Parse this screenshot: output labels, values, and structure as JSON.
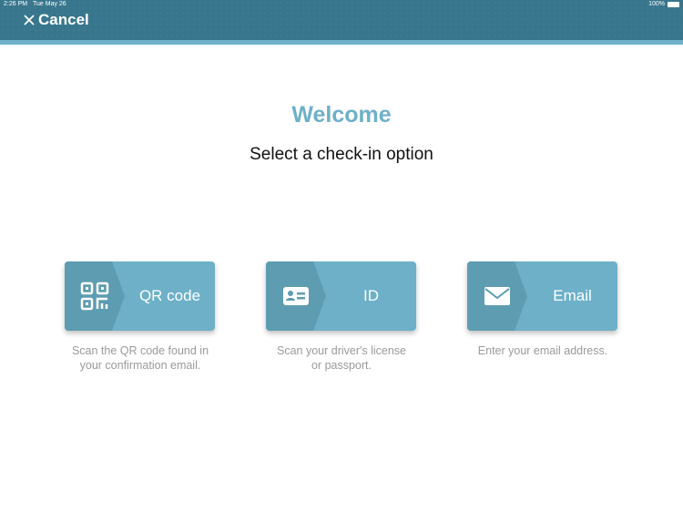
{
  "status_bar": {
    "time": "2:26 PM",
    "date": "Tue May 26",
    "battery": "100%"
  },
  "header": {
    "cancel_label": "Cancel"
  },
  "main": {
    "title": "Welcome",
    "subtitle": "Select a check-in option",
    "options": [
      {
        "label": "QR code",
        "icon": "qr-code-icon",
        "description_line1": "Scan the QR code found in",
        "description_line2": "your confirmation email."
      },
      {
        "label": "ID",
        "icon": "id-card-icon",
        "description_line1": "Scan your driver's license",
        "description_line2": "or passport."
      },
      {
        "label": "Email",
        "icon": "envelope-icon",
        "description_line1": "Enter your email address.",
        "description_line2": ""
      }
    ]
  },
  "colors": {
    "header": "#38768d",
    "accent": "#6db0c8",
    "accent_dark": "#5e9cb2"
  }
}
